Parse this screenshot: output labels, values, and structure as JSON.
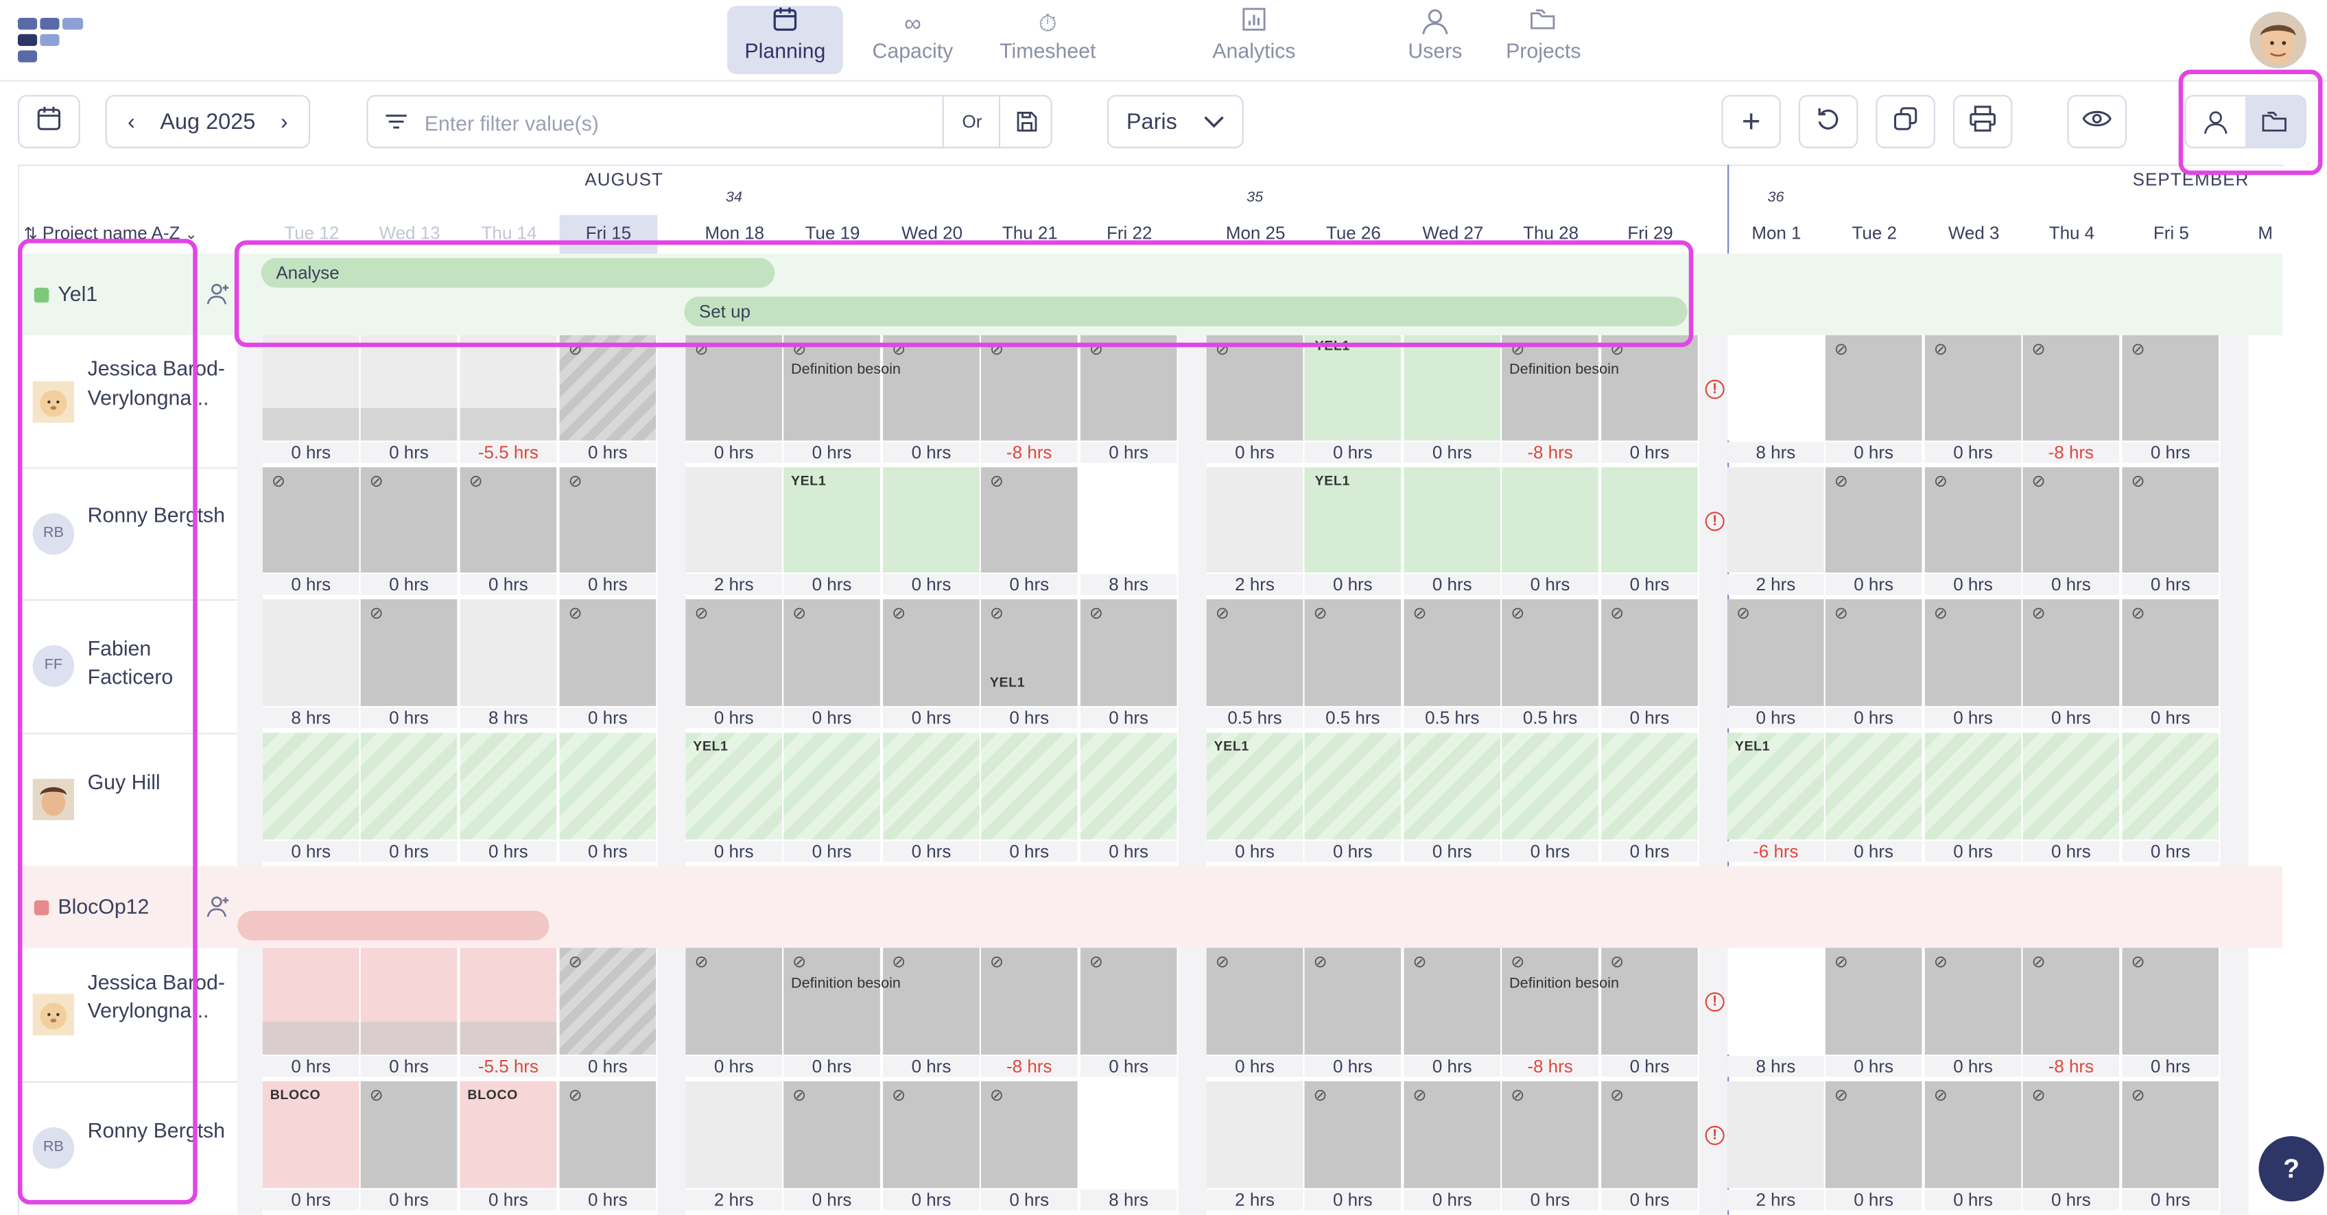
{
  "nav": {
    "items": [
      {
        "label": "Planning",
        "icon": "calendar-icon",
        "active": true
      },
      {
        "label": "Capacity",
        "icon": "infinity-icon"
      },
      {
        "label": "Timesheet",
        "icon": "stopwatch-icon"
      },
      {
        "label": "Analytics",
        "icon": "bar-chart-icon"
      },
      {
        "label": "Users",
        "icon": "user-icon"
      },
      {
        "label": "Projects",
        "icon": "folders-icon"
      }
    ]
  },
  "toolbar": {
    "month": "Aug 2025",
    "filter_placeholder": "Enter filter value(s)",
    "or_label": "Or",
    "location": "Paris",
    "view_user_icon": "user-icon",
    "view_project_icon": "folders-icon"
  },
  "calendar": {
    "month_august": "AUGUST",
    "month_september": "SEPTEMBER",
    "weeks": [
      "34",
      "35",
      "36"
    ],
    "sort_label": "Project name A-Z",
    "days": [
      "Tue 12",
      "Wed 13",
      "Thu 14",
      "Fri 15",
      "Mon 18",
      "Tue 19",
      "Wed 20",
      "Thu 21",
      "Fri 22",
      "Mon 25",
      "Tue 26",
      "Wed 27",
      "Thu 28",
      "Fri 29",
      "Mon 1",
      "Tue 2",
      "Wed 3",
      "Thu 4",
      "Fri 5",
      "M"
    ]
  },
  "projects": [
    {
      "name": "Yel1",
      "color": "#7cc97a",
      "phases": [
        "Analyse",
        "Set up"
      ],
      "people": [
        {
          "name": "Jessica Barod-Verylongna...",
          "initials": "",
          "hours": [
            "0 hrs",
            "0 hrs",
            "-5.5 hrs",
            "0 hrs",
            "0 hrs",
            "0 hrs",
            "0 hrs",
            "-8 hrs",
            "0 hrs",
            "0 hrs",
            "0 hrs",
            "0 hrs",
            "-8 hrs",
            "0 hrs",
            "8 hrs",
            "0 hrs",
            "0 hrs",
            "-8 hrs",
            "0 hrs"
          ],
          "notes": [
            "Definition besoin",
            "YEL1",
            "Definition besoin"
          ]
        },
        {
          "name": "Ronny Bergtsh",
          "initials": "RB",
          "hours": [
            "0 hrs",
            "0 hrs",
            "0 hrs",
            "0 hrs",
            "2 hrs",
            "0 hrs",
            "0 hrs",
            "0 hrs",
            "8 hrs",
            "2 hrs",
            "0 hrs",
            "0 hrs",
            "0 hrs",
            "0 hrs",
            "2 hrs",
            "0 hrs",
            "0 hrs",
            "0 hrs",
            "0 hrs"
          ],
          "notes": [
            "YEL1",
            "YEL1"
          ]
        },
        {
          "name": "Fabien Facticero",
          "initials": "FF",
          "hours": [
            "8 hrs",
            "0 hrs",
            "8 hrs",
            "0 hrs",
            "0 hrs",
            "0 hrs",
            "0 hrs",
            "0 hrs",
            "0 hrs",
            "0.5 hrs",
            "0.5 hrs",
            "0.5 hrs",
            "0.5 hrs",
            "0 hrs",
            "0 hrs",
            "0 hrs",
            "0 hrs",
            "0 hrs",
            "0 hrs"
          ],
          "notes": [
            "YEL1"
          ]
        },
        {
          "name": "Guy Hill",
          "initials": "",
          "hours": [
            "0 hrs",
            "0 hrs",
            "0 hrs",
            "0 hrs",
            "0 hrs",
            "0 hrs",
            "0 hrs",
            "0 hrs",
            "0 hrs",
            "0 hrs",
            "0 hrs",
            "0 hrs",
            "0 hrs",
            "0 hrs",
            "-6 hrs",
            "0 hrs",
            "0 hrs",
            "0 hrs",
            "0 hrs"
          ],
          "notes": [
            "YEL1",
            "YEL1",
            "YEL1"
          ]
        }
      ]
    },
    {
      "name": "BlocOp12",
      "color": "#e88a8a",
      "people": [
        {
          "name": "Jessica Barod-Verylongna...",
          "initials": "",
          "hours": [
            "0 hrs",
            "0 hrs",
            "-5.5 hrs",
            "0 hrs",
            "0 hrs",
            "0 hrs",
            "0 hrs",
            "-8 hrs",
            "0 hrs",
            "0 hrs",
            "0 hrs",
            "0 hrs",
            "-8 hrs",
            "0 hrs",
            "8 hrs",
            "0 hrs",
            "0 hrs",
            "-8 hrs",
            "0 hrs"
          ],
          "notes": [
            "Definition besoin",
            "Definition besoin"
          ]
        },
        {
          "name": "Ronny Bergtsh",
          "initials": "RB",
          "hours": [
            "0 hrs",
            "0 hrs",
            "0 hrs",
            "0 hrs",
            "2 hrs",
            "0 hrs",
            "0 hrs",
            "0 hrs",
            "8 hrs",
            "2 hrs",
            "0 hrs",
            "0 hrs",
            "0 hrs",
            "0 hrs",
            "2 hrs",
            "0 hrs",
            "0 hrs",
            "0 hrs",
            "0 hrs"
          ],
          "notes": [
            "BLOCO",
            "BLOCO"
          ]
        }
      ]
    }
  ],
  "help_label": "?"
}
